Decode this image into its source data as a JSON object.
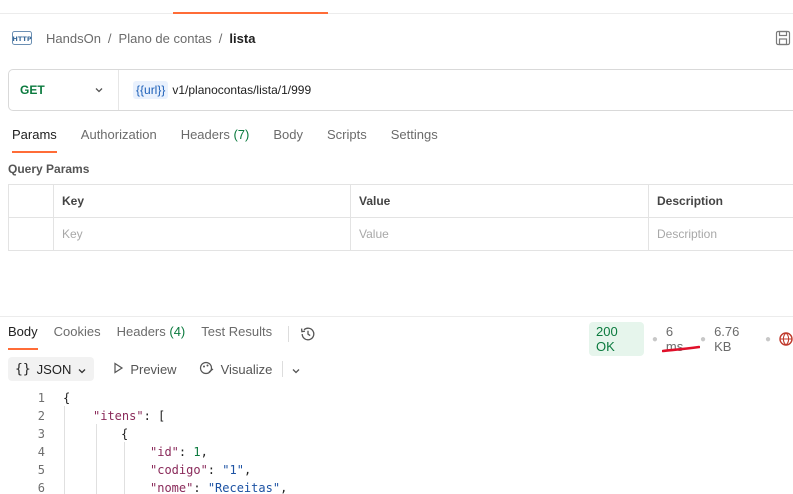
{
  "breadcrumb": {
    "icon": "http-icon",
    "items": [
      "HandsOn",
      "Plano de contas"
    ],
    "current": "lista",
    "sep": "/"
  },
  "request": {
    "method": "GET",
    "url_variable": "{{url}}",
    "url_path": "v1/planocontas/lista/1/999"
  },
  "request_tabs": [
    {
      "label": "Params",
      "count": ""
    },
    {
      "label": "Authorization",
      "count": ""
    },
    {
      "label": "Headers",
      "count": "(7)"
    },
    {
      "label": "Body",
      "count": ""
    },
    {
      "label": "Scripts",
      "count": ""
    },
    {
      "label": "Settings",
      "count": ""
    }
  ],
  "query_params": {
    "title": "Query Params",
    "headers": [
      "Key",
      "Value",
      "Description"
    ],
    "placeholders": [
      "Key",
      "Value",
      "Description"
    ]
  },
  "response_tabs": [
    {
      "label": "Body",
      "count": ""
    },
    {
      "label": "Cookies",
      "count": ""
    },
    {
      "label": "Headers",
      "count": "(4)"
    },
    {
      "label": "Test Results",
      "count": ""
    }
  ],
  "response_status": {
    "status": "200 OK",
    "time": "6 ms",
    "size": "6.76 KB",
    "status_color": "#0b7a3e",
    "annotation_color": "#e0102a"
  },
  "response_toolbar": {
    "format_label": "JSON",
    "preview_label": "Preview",
    "visualize_label": "Visualize"
  },
  "code_lines": [
    {
      "num": "1",
      "text": "{"
    },
    {
      "num": "2",
      "key": "\"itens\"",
      "rest": ": ["
    },
    {
      "num": "3",
      "text": "{"
    },
    {
      "num": "4",
      "key": "\"id\"",
      "rest": ": ",
      "value": "1",
      "tail": ","
    },
    {
      "num": "5",
      "key": "\"codigo\"",
      "rest": ": ",
      "value": "\"1\"",
      "tail": ","
    },
    {
      "num": "6",
      "key": "\"nome\"",
      "rest": ": ",
      "value": "\"Receitas\"",
      "tail": ","
    }
  ]
}
